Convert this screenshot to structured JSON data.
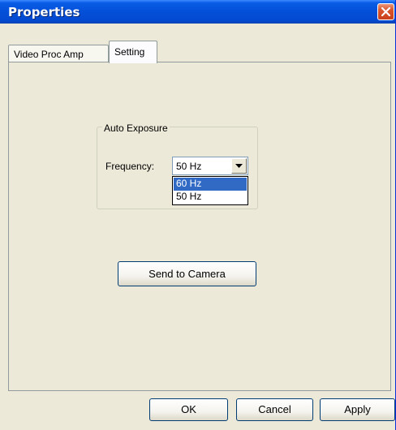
{
  "window": {
    "title": "Properties",
    "close_icon": "close-icon"
  },
  "tabs": [
    {
      "label": "Video Proc Amp",
      "selected": false
    },
    {
      "label": "Setting",
      "selected": true
    }
  ],
  "auto_exposure": {
    "group_label": "Auto Exposure",
    "frequency_label": "Frequency:",
    "frequency_value": "50 Hz",
    "options": [
      "60 Hz",
      "50 Hz"
    ],
    "highlighted_option": "60 Hz"
  },
  "send_button_label": "Send to Camera",
  "footer": {
    "ok_label": "OK",
    "cancel_label": "Cancel",
    "apply_label": "Apply"
  },
  "colors": {
    "title_bar": "#0450d8",
    "dialog_face": "#ece9d8",
    "selection": "#316ac5"
  }
}
